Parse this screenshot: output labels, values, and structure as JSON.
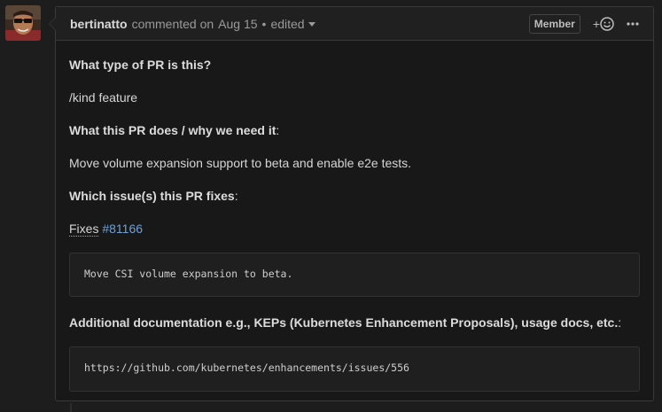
{
  "comment": {
    "author": "bertinatto",
    "action": "commented on",
    "date": "Aug 15",
    "separator": "•",
    "edited": "edited",
    "badge": "Member",
    "reaction_plus": "+",
    "icons": {
      "reaction": "smiley-icon",
      "menu": "kebab-icon",
      "edited_dropdown": "chevron-down-icon"
    }
  },
  "body": {
    "q1": "What type of PR is this?",
    "kind": "/kind feature",
    "q2": "What this PR does / why we need it",
    "q2_suffix": ":",
    "move": "Move volume expansion support to beta and enable e2e tests.",
    "q3": "Which issue(s) this PR fixes",
    "q3_suffix": ":",
    "fixes_word": "Fixes",
    "fixes_issue": "#81166",
    "code1": "Move CSI volume expansion to beta.",
    "q4": "Additional documentation e.g., KEPs (Kubernetes Enhancement Proposals), usage docs, etc.",
    "q4_suffix": ":",
    "code2": "https://github.com/kubernetes/enhancements/issues/556"
  },
  "colors": {
    "background": "#1d1d1d",
    "panel": "#181818",
    "header": "#202020",
    "link": "#6ea2d6"
  }
}
